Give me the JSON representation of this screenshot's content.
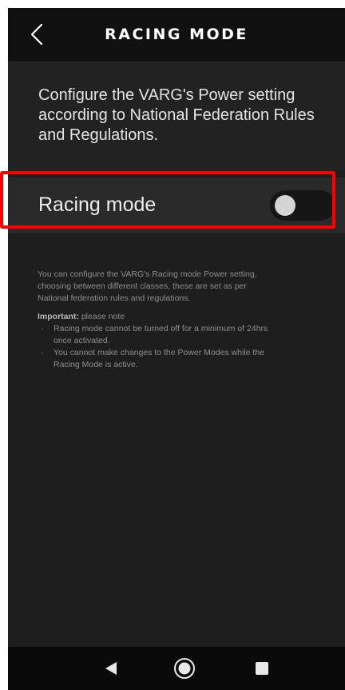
{
  "header": {
    "title": "RACING MODE",
    "back_icon": "chevron-left-icon"
  },
  "intro": {
    "text": "Configure the VARG's Power setting according to National Federation Rules and Regulations."
  },
  "racing_toggle": {
    "label": "Racing mode",
    "state": "off"
  },
  "info": {
    "description": "You can configure the VARG's Racing mode Power setting, choosing between different classes, these are set as per National federation rules and regulations.",
    "note_label": "Important:",
    "note_text": " please note",
    "bullets": [
      "Racing mode cannot be turned off for a minimum of 24hrs once activated.",
      "You cannot make changes to the Power Modes while the Racing Mode is active."
    ],
    "bullet_glyph": "·"
  },
  "navbar": {
    "back_icon": "triangle-back-icon",
    "home_icon": "circle-home-icon",
    "recents_icon": "square-recents-icon"
  },
  "colors": {
    "background": "#1e1e1e",
    "header": "#111111",
    "highlight": "#ff0000",
    "toggle_knob": "#d4d4d4"
  }
}
